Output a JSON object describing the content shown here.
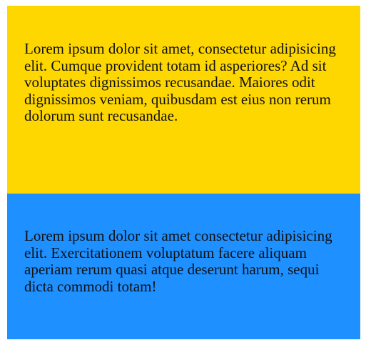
{
  "boxes": [
    {
      "text": "Lorem ipsum dolor sit amet, consectetur adipisicing elit. Cumque provident totam id asperiores? Ad sit voluptates dignissimos recusandae. Maiores odit dignissimos veniam, quibusdam est eius non rerum dolorum sunt recusandae.",
      "background": "#ffd700"
    },
    {
      "text": "Lorem ipsum dolor sit amet consectetur adipisicing elit. Exercitationem voluptatum facere aliquam aperiam rerum quasi atque deserunt harum, sequi dicta commodi totam!",
      "background": "#1e90ff"
    }
  ]
}
